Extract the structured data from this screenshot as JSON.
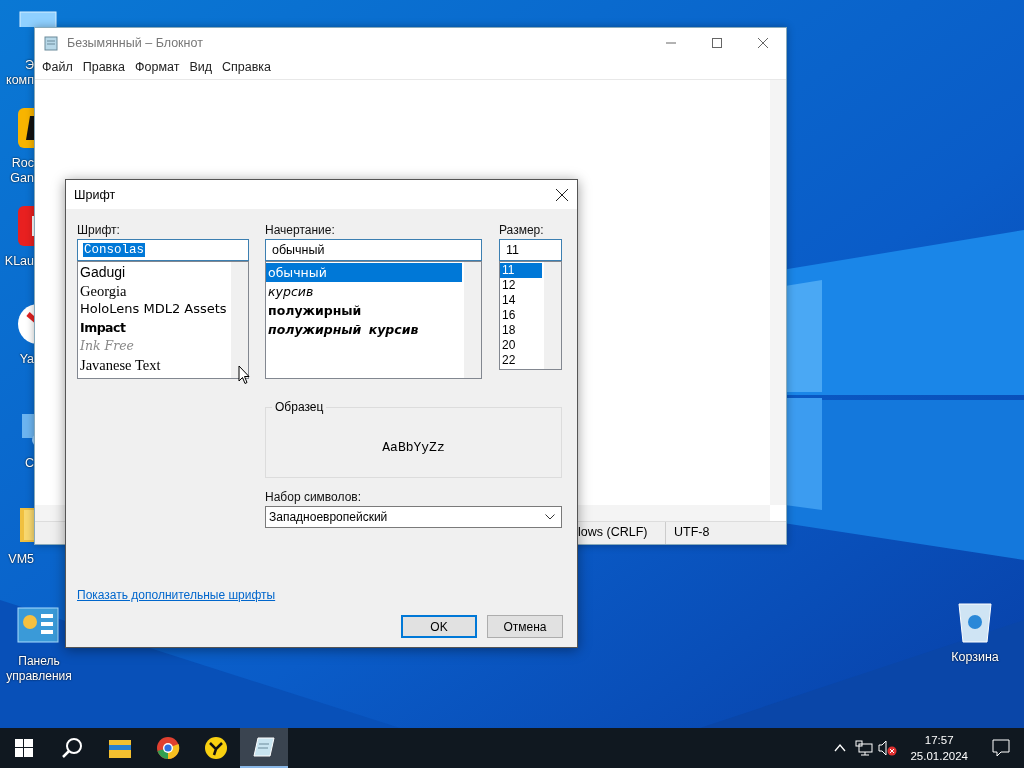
{
  "desktop": {
    "icons": [
      {
        "kind": "computer",
        "lines": [
          "Э",
          "комп"
        ]
      },
      {
        "kind": "game",
        "lines": [
          "Roc",
          "Gan"
        ]
      },
      {
        "kind": "launcher",
        "lines": [
          "KLau"
        ]
      },
      {
        "kind": "browser",
        "lines": [
          "Ya"
        ]
      },
      {
        "kind": "network",
        "lines": [
          "C"
        ]
      },
      {
        "kind": "folder",
        "lines": [
          "VM5"
        ]
      },
      {
        "kind": "control-panel",
        "lines": [
          "Панель",
          "управления"
        ]
      }
    ],
    "recycle_bin": {
      "label": "Корзина"
    }
  },
  "notepad": {
    "title": "Безымянный – Блокнот",
    "menu": [
      "Файл",
      "Правка",
      "Формат",
      "Вид",
      "Справка"
    ],
    "status": [
      "lows (CRLF)",
      "UTF-8"
    ]
  },
  "font_dialog": {
    "title": "Шрифт",
    "font": {
      "label": "Шрифт:",
      "value": "Consolas",
      "items": [
        {
          "text": "Gadugi",
          "kind": "sans"
        },
        {
          "text": "Georgia",
          "kind": "serif"
        },
        {
          "text": "HoloLens MDL2 Assets",
          "kind": "wide"
        },
        {
          "text": "Impact",
          "kind": "heavy"
        },
        {
          "text": "Ink Free",
          "kind": "script"
        },
        {
          "text": "Javanese Text",
          "kind": "serif"
        }
      ]
    },
    "style": {
      "label": "Начертание:",
      "value": "обычный",
      "items": [
        {
          "text": "обычный",
          "kind": "regular",
          "selected": true
        },
        {
          "text": "курсив",
          "kind": "italic",
          "selected": false
        },
        {
          "text": "полужирный",
          "kind": "bold",
          "selected": false
        },
        {
          "text": "полужирный курсив",
          "kind": "bold-italic",
          "selected": false
        }
      ]
    },
    "size": {
      "label": "Размер:",
      "value": "11",
      "items": [
        {
          "text": "11",
          "selected": true
        },
        {
          "text": "12",
          "selected": false
        },
        {
          "text": "14",
          "selected": false
        },
        {
          "text": "16",
          "selected": false
        },
        {
          "text": "18",
          "selected": false
        },
        {
          "text": "20",
          "selected": false
        },
        {
          "text": "22",
          "selected": false
        }
      ]
    },
    "sample": {
      "label": "Образец",
      "text": "AaBbYyZz"
    },
    "charset": {
      "label": "Набор символов:",
      "value": "Западноевропейский"
    },
    "link": "Показать дополнительные шрифты",
    "buttons": [
      {
        "label": "OK",
        "default": true
      },
      {
        "label": "Отмена",
        "default": false
      }
    ]
  },
  "taskbar": {
    "apps": [
      {
        "kind": "explorer",
        "active": false
      },
      {
        "kind": "chrome",
        "active": false
      },
      {
        "kind": "yandex",
        "active": false
      },
      {
        "kind": "notepad",
        "active": true
      }
    ],
    "tray": {
      "muted": true,
      "time": "17:57",
      "date": "25.01.2024"
    }
  }
}
